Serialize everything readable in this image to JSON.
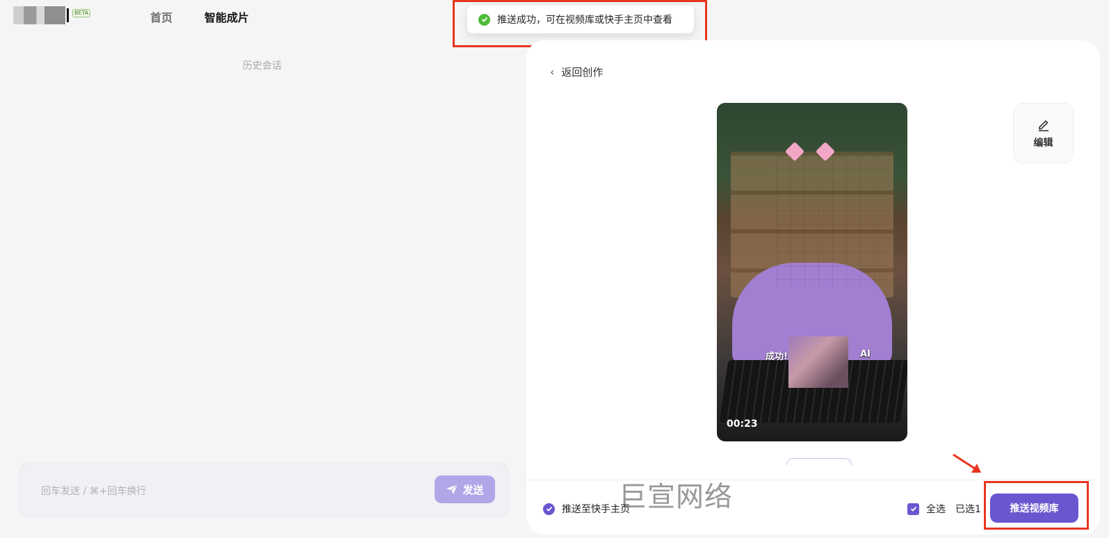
{
  "header": {
    "beta_badge": "BETA",
    "nav": [
      {
        "label": "首页"
      },
      {
        "label": "智能成片"
      }
    ]
  },
  "toast": {
    "message": "推送成功，可在视频库或快手主页中查看",
    "status_color": "#4fbb3b"
  },
  "left_panel": {
    "history_label": "历史会话",
    "input_placeholder": "回车发送 / ⌘+回车换行",
    "send_label": "发送"
  },
  "right_panel": {
    "back_label": "返回创作",
    "edit_label": "编辑",
    "video": {
      "duration": "00:23",
      "caption_left": "成功!",
      "caption_right": "AI"
    },
    "push_home_label": "推送至快手主页",
    "select_all_label": "全选",
    "selected_count": "已选1",
    "push_library_label": "推送视频库"
  },
  "watermark": "巨宣网络",
  "colors": {
    "accent": "#6a56cf",
    "annotation": "#e8351e"
  }
}
